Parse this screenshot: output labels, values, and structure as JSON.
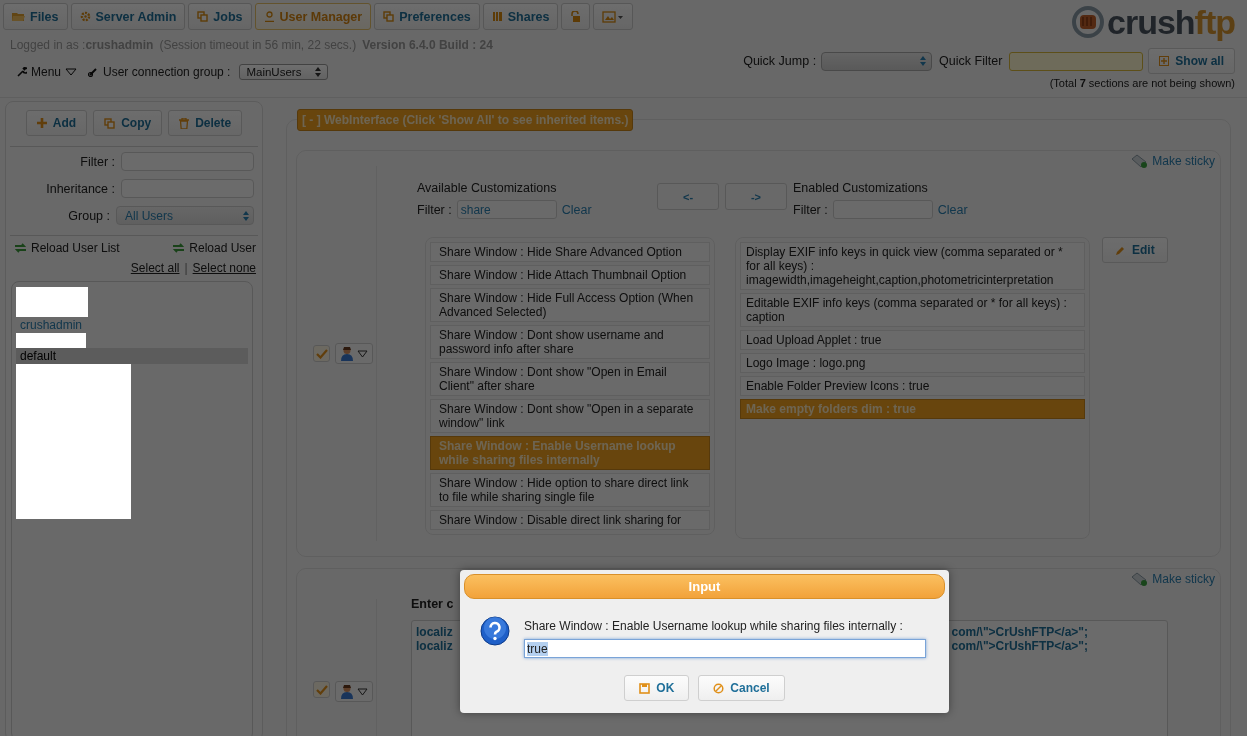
{
  "tabs": [
    {
      "label": "Files",
      "selected": false
    },
    {
      "label": "Server Admin",
      "selected": false
    },
    {
      "label": "Jobs",
      "selected": false
    },
    {
      "label": "User Manager",
      "selected": true
    },
    {
      "label": "Preferences",
      "selected": false
    },
    {
      "label": "Shares",
      "selected": false
    },
    {
      "selected": false
    },
    {
      "selected": false
    }
  ],
  "session": {
    "label": "Logged in as :",
    "user": "crushadmin",
    "timeout": "(Session timeout in 56 min, 22 secs.)",
    "version": "Version 6.4.0 Build : 24"
  },
  "menu": {
    "label": "Menu",
    "group_label": "User connection group :",
    "group_value": "MainUsers"
  },
  "logo": {
    "text_1": "crush",
    "text_2": "ftp"
  },
  "quick": {
    "jump_label": "Quick Jump :",
    "filter_label": "Quick Filter",
    "show_all": "Show all",
    "note": "(Total **7** sections are not being shown)"
  },
  "sidebar": {
    "buttons": [
      "Add",
      "Copy",
      "Delete"
    ],
    "filter_label": "Filter :",
    "inheritance_label": "Inheritance :",
    "group_label": "Group :",
    "group_value": "All Users",
    "reload_list": "Reload User List",
    "reload_user": "Reload User",
    "select_all": "Select all",
    "select_none": "Select none",
    "separator": "|",
    "users": [
      {
        "kind": "redacted"
      },
      {
        "kind": "user",
        "name": "crushadmin",
        "selected": false
      },
      {
        "kind": "redacted"
      },
      {
        "kind": "user",
        "name": "default",
        "selected": true
      },
      {
        "kind": "redacted"
      }
    ]
  },
  "section": {
    "title": "[ - ] WebInterface (Click 'Show All' to see inherited items.)"
  },
  "card_1": {
    "make_sticky": "Make sticky",
    "checked": true,
    "available": {
      "title": "Available Customizations",
      "filter_label": "Filter :",
      "filter_value": "share",
      "clear": "Clear",
      "items": [
        {
          "text": "Share Window : Hide Share Advanced Option",
          "selected": false
        },
        {
          "text": "Share Window : Hide Attach Thumbnail Option",
          "selected": false
        },
        {
          "text": "Share Window : Hide Full Access Option (When Advanced Selected)",
          "selected": false
        },
        {
          "text": "Share Window : Dont show username and password info after share",
          "selected": false
        },
        {
          "text": "Share Window : Dont show \"Open in Email Client\" after share",
          "selected": false
        },
        {
          "text": "Share Window : Dont show \"Open in a separate window\" link",
          "selected": false
        },
        {
          "text": "Share Window : Enable Username lookup while sharing files internally",
          "selected": true
        },
        {
          "text": "Share Window : Hide option to share direct link to file while sharing single file",
          "selected": false
        },
        {
          "text": "Share Window : Disable direct link sharing for",
          "selected": false
        }
      ]
    },
    "move_left": "<-",
    "move_right": "->",
    "enabled": {
      "title": "Enabled Customizations",
      "filter_label": "Filter :",
      "clear": "Clear",
      "items": [
        {
          "text": "Display EXIF info keys in quick view (comma separated or * for all keys) : imagewidth,imageheight,caption,photometricinterpretation",
          "selected": false
        },
        {
          "text": "Editable EXIF info keys (comma separated or * for all keys) : caption",
          "selected": false
        },
        {
          "text": "Load Upload Applet : true",
          "selected": false
        },
        {
          "text": "Logo Image : logo.png",
          "selected": false
        },
        {
          "text": "Enable Folder Preview Icons : true",
          "selected": false
        },
        {
          "text": "Make empty folders dim : true",
          "selected": true
        }
      ]
    },
    "edit": "Edit"
  },
  "card_2": {
    "make_sticky": "Make sticky",
    "checked": true,
    "label": "Enter c",
    "lines": [
      {
        "start": "localiz",
        "end": "com/\\\">CrUshFTP</a>\";"
      },
      {
        "start": "localiz",
        "end": "com/\\\">CrUshFTP</a>\";"
      }
    ]
  },
  "dialog": {
    "title": "Input",
    "prompt": "Share Window : Enable Username lookup while sharing files internally :",
    "value": "true",
    "ok": "OK",
    "cancel": "Cancel"
  }
}
